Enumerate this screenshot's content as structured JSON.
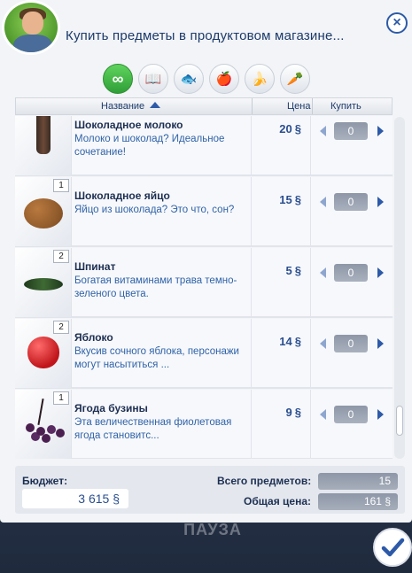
{
  "window": {
    "title": "Купить предметы в продуктовом магазине...",
    "close_label": "×"
  },
  "background": {
    "paused_text": "ПАУЗА"
  },
  "tabs": [
    {
      "name": "all",
      "icon": "infinity-icon",
      "glyph": "∞",
      "active": true
    },
    {
      "name": "books",
      "icon": "book-icon",
      "glyph": "📖",
      "active": false
    },
    {
      "name": "fish",
      "icon": "fish-icon",
      "glyph": "🐟",
      "active": false
    },
    {
      "name": "fruit",
      "icon": "apple-icon",
      "glyph": "🍎",
      "active": false
    },
    {
      "name": "produce",
      "icon": "banana-icon",
      "glyph": "🍌",
      "active": false
    },
    {
      "name": "vegetables",
      "icon": "carrot-icon",
      "glyph": "🥕",
      "active": false
    }
  ],
  "columns": {
    "name": "Название",
    "price": "Цена",
    "buy": "Купить"
  },
  "currency_symbol": "§",
  "items": [
    {
      "badge": "",
      "name": "Шоколадное молоко",
      "desc": "Молоко и шоколад? Идеальное сочетание!",
      "price": "20",
      "qty": "0",
      "icon": "chocolate-milk-bottle-icon"
    },
    {
      "badge": "1",
      "name": "Шоколадное яйцо",
      "desc": "Яйцо из шоколада? Это что, сон?",
      "price": "15",
      "qty": "0",
      "icon": "chocolate-egg-icon"
    },
    {
      "badge": "2",
      "name": "Шпинат",
      "desc": "Богатая витаминами трава темно-зеленого цвета.",
      "price": "5",
      "qty": "0",
      "icon": "spinach-icon"
    },
    {
      "badge": "2",
      "name": "Яблоко",
      "desc": "Вкусив сочного яблока, персонажи могут насытиться ...",
      "price": "14",
      "qty": "0",
      "icon": "apple-icon"
    },
    {
      "badge": "1",
      "name": "Ягода бузины",
      "desc": "Эта величественная фиолетовая ягода становитс...",
      "price": "9",
      "qty": "0",
      "icon": "elderberry-icon"
    }
  ],
  "footer": {
    "budget_label": "Бюджет:",
    "budget_value": "3 615",
    "total_items_label": "Всего предметов:",
    "total_items_value": "15",
    "total_price_label": "Общая цена:",
    "total_price_value": "161"
  },
  "colors": {
    "accent": "#2d5aa8",
    "active_tab": "#3ab041",
    "text_dark": "#1d2f52",
    "text_blue": "#2f63a8"
  }
}
